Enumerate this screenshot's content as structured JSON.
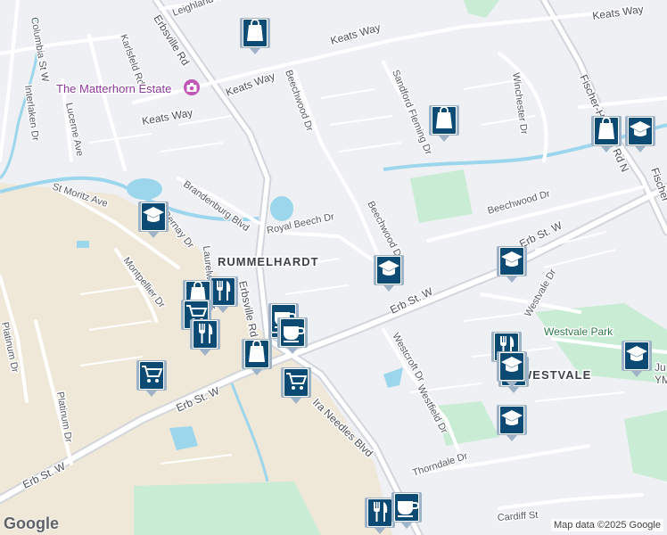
{
  "map": {
    "streets": [
      {
        "label": "Leighland Dr"
      },
      {
        "label": "Erbsville Rd"
      },
      {
        "label": "Keats Way"
      },
      {
        "label": "Keats Way"
      },
      {
        "label": "Keats Way"
      },
      {
        "label": "Keats Way"
      },
      {
        "label": "Karlsfeld Rd"
      },
      {
        "label": "Columbia St W"
      },
      {
        "label": "Interlaken Dr"
      },
      {
        "label": "Lucerne Ave"
      },
      {
        "label": "Beechwood Dr"
      },
      {
        "label": "Sandford Fleming Dr"
      },
      {
        "label": "Winchester Dr"
      },
      {
        "label": "Fischer-Hallman Rd N"
      },
      {
        "label": "St Moritz Ave"
      },
      {
        "label": "Brandenburg Blvd"
      },
      {
        "label": "Bernay Dr"
      },
      {
        "label": "Royal Beech Dr"
      },
      {
        "label": "Beechwood Dr"
      },
      {
        "label": "Beechwood Dr"
      },
      {
        "label": "Erb St. W"
      },
      {
        "label": "Erb St. W"
      },
      {
        "label": "Erb St. W"
      },
      {
        "label": "Erb St. W"
      },
      {
        "label": "Montpellier Dr"
      },
      {
        "label": "Erbsville Rd"
      },
      {
        "label": "Westvale Dr"
      },
      {
        "label": "Westcroft Dr"
      },
      {
        "label": "Westfield Dr"
      },
      {
        "label": "Laurelwood Dr"
      },
      {
        "label": "Platinum Dr"
      },
      {
        "label": "Platinum Dr"
      },
      {
        "label": "Ira Needles Blvd"
      },
      {
        "label": "Thorndale Dr"
      },
      {
        "label": "Cardiff St"
      },
      {
        "label": "Fischer"
      }
    ],
    "neighbourhoods": [
      "RUMMELHARDT",
      "WESTVALE"
    ],
    "parks": [
      "Westvale Park"
    ],
    "partial_labels": [
      "Ju",
      "YM"
    ],
    "poi": {
      "name": "The Matterhorn Estate",
      "icon": "camera-icon"
    },
    "markers": [
      {
        "type": "shopping",
        "icon": "shopping-bag-icon"
      },
      {
        "type": "education",
        "icon": "graduation-cap-icon"
      },
      {
        "type": "shopping",
        "icon": "shopping-bag-icon"
      },
      {
        "type": "shopping",
        "icon": "shopping-bag-icon"
      },
      {
        "type": "education",
        "icon": "graduation-cap-icon"
      },
      {
        "type": "education",
        "icon": "graduation-cap-icon"
      },
      {
        "type": "education",
        "icon": "graduation-cap-icon"
      },
      {
        "type": "restaurant",
        "icon": "fork-knife-icon"
      },
      {
        "type": "shopping",
        "icon": "shopping-bag-icon"
      },
      {
        "type": "grocery",
        "icon": "shopping-cart-icon"
      },
      {
        "type": "grocery",
        "icon": "shopping-cart-icon"
      },
      {
        "type": "restaurant",
        "icon": "fork-knife-icon"
      },
      {
        "type": "cafe",
        "icon": "coffee-cup-icon"
      },
      {
        "type": "cafe",
        "icon": "coffee-cup-icon"
      },
      {
        "type": "shopping",
        "icon": "shopping-bag-icon"
      },
      {
        "type": "grocery",
        "icon": "shopping-cart-icon"
      },
      {
        "type": "grocery",
        "icon": "shopping-cart-icon"
      },
      {
        "type": "education",
        "icon": "graduation-cap-icon"
      },
      {
        "type": "restaurant",
        "icon": "fork-knife-icon"
      },
      {
        "type": "education",
        "icon": "graduation-cap-icon"
      },
      {
        "type": "education",
        "icon": "graduation-cap-icon"
      },
      {
        "type": "education",
        "icon": "graduation-cap-icon"
      },
      {
        "type": "restaurant",
        "icon": "fork-knife-icon"
      },
      {
        "type": "cafe",
        "icon": "coffee-cup-icon"
      }
    ],
    "colors": {
      "background": "#eef0f3",
      "road": "#ffffff",
      "highway": "#d2d6dc",
      "park": "#c9ecd4",
      "water": "#9cd6ec",
      "commercial": "#efe7d8",
      "marker_fill": "#0b4a73",
      "marker_border": "#9fb3c8"
    }
  },
  "footer": {
    "logo": "Google",
    "attribution": "Map data ©2025 Google"
  }
}
